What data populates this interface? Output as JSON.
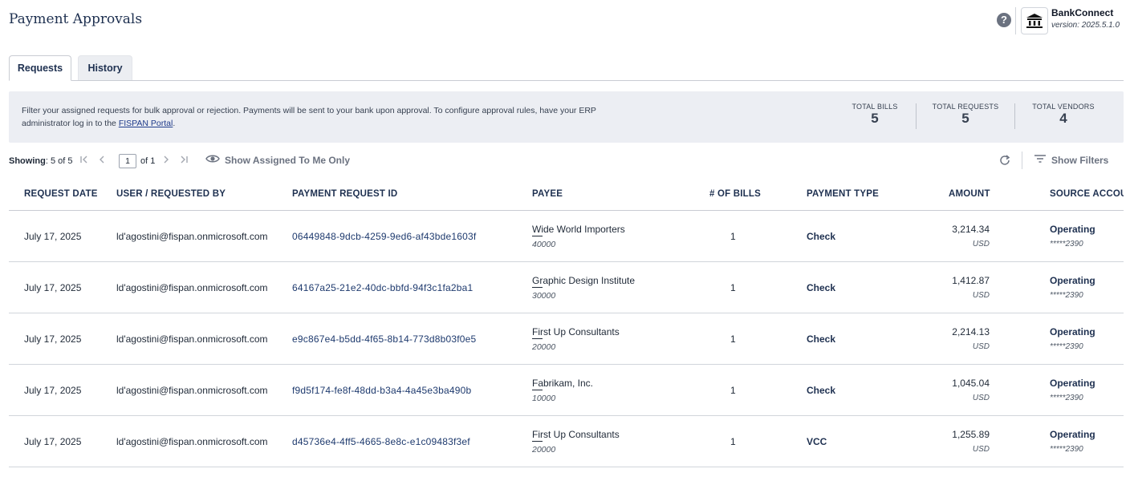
{
  "header": {
    "title": "Payment Approvals",
    "brand_name": "BankConnect",
    "brand_version": "version: 2025.5.1.0"
  },
  "tabs": [
    {
      "label": "Requests",
      "active": true
    },
    {
      "label": "History",
      "active": false
    }
  ],
  "info": {
    "text_part1": "Filter your assigned requests for bulk approval or rejection. Payments will be sent to your bank upon approval. To configure approval rules, have your ERP administrator log in to the ",
    "link_text": "FISPAN Portal",
    "text_part2": "."
  },
  "stats": [
    {
      "label": "TOTAL BILLS",
      "value": "5"
    },
    {
      "label": "TOTAL REQUESTS",
      "value": "5"
    },
    {
      "label": "TOTAL VENDORS",
      "value": "4"
    }
  ],
  "toolbar": {
    "showing_label": "Showing",
    "showing_value": ": 5 of 5",
    "page_current": "1",
    "page_of": "of 1",
    "assigned_label": "Show Assigned To Me Only",
    "filters_label": "Show Filters"
  },
  "table": {
    "headers": [
      "REQUEST DATE",
      "USER / REQUESTED BY",
      "PAYMENT REQUEST ID",
      "PAYEE",
      "# OF BILLS",
      "PAYMENT TYPE",
      "AMOUNT",
      "SOURCE ACCOU"
    ],
    "rows": [
      {
        "date": "July 17, 2025",
        "user": "ld'agostini@fispan.onmicrosoft.com",
        "request_id": "06449848-9dcb-4259-9ed6-af43bde1603f",
        "payee": "Wide World Importers",
        "payee_id": "40000",
        "bills": "1",
        "type": "Check",
        "amount": "3,214.34",
        "currency": "USD",
        "source": "Operating",
        "account": "*****2390"
      },
      {
        "date": "July 17, 2025",
        "user": "ld'agostini@fispan.onmicrosoft.com",
        "request_id": "64167a25-21e2-40dc-bbfd-94f3c1fa2ba1",
        "payee": "Graphic Design Institute",
        "payee_id": "30000",
        "bills": "1",
        "type": "Check",
        "amount": "1,412.87",
        "currency": "USD",
        "source": "Operating",
        "account": "*****2390"
      },
      {
        "date": "July 17, 2025",
        "user": "ld'agostini@fispan.onmicrosoft.com",
        "request_id": "e9c867e4-b5dd-4f65-8b14-773d8b03f0e5",
        "payee": "First Up Consultants",
        "payee_id": "20000",
        "bills": "1",
        "type": "Check",
        "amount": "2,214.13",
        "currency": "USD",
        "source": "Operating",
        "account": "*****2390"
      },
      {
        "date": "July 17, 2025",
        "user": "ld'agostini@fispan.onmicrosoft.com",
        "request_id": "f9d5f174-fe8f-48dd-b3a4-4a45e3ba490b",
        "payee": "Fabrikam, Inc.",
        "payee_id": "10000",
        "bills": "1",
        "type": "Check",
        "amount": "1,045.04",
        "currency": "USD",
        "source": "Operating",
        "account": "*****2390"
      },
      {
        "date": "July 17, 2025",
        "user": "ld'agostini@fispan.onmicrosoft.com",
        "request_id": "d45736e4-4ff5-4665-8e8c-e1c09483f3ef",
        "payee": "First Up Consultants",
        "payee_id": "20000",
        "bills": "1",
        "type": "VCC",
        "amount": "1,255.89",
        "currency": "USD",
        "source": "Operating",
        "account": "*****2390"
      }
    ]
  }
}
